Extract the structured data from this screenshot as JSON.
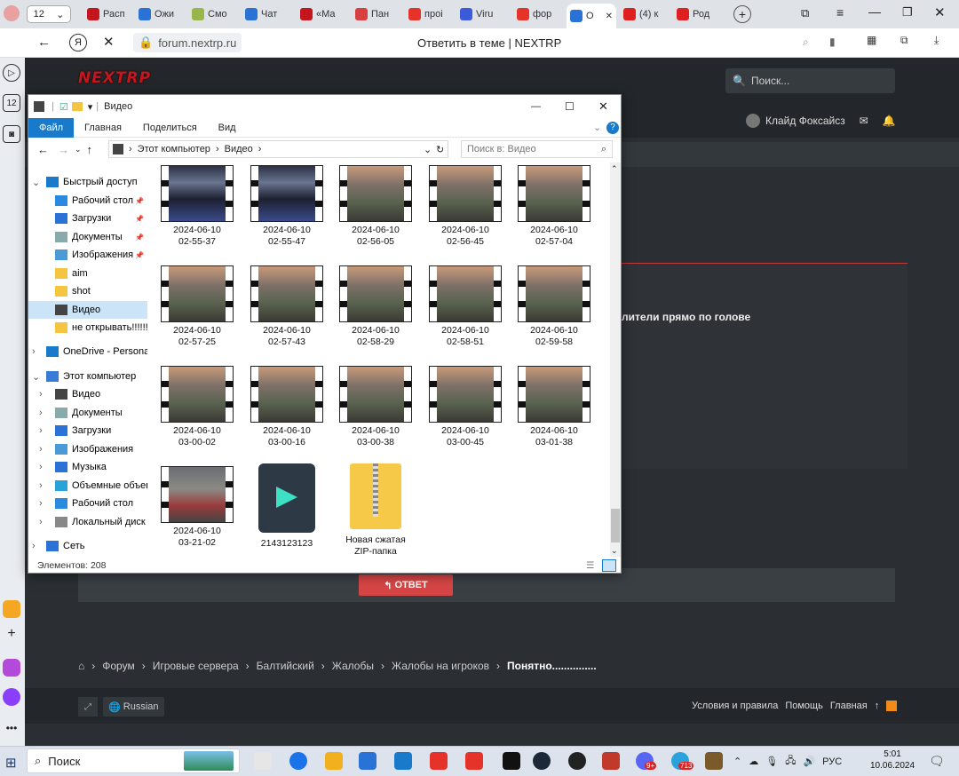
{
  "browser": {
    "tab_count": "12",
    "tabs": [
      {
        "label": "Расп",
        "color": "#c4161c"
      },
      {
        "label": "Ожи",
        "color": "#2a72d5"
      },
      {
        "label": "Смо",
        "color": "#9ab54a"
      },
      {
        "label": "Чат",
        "color": "#2a72d5"
      },
      {
        "label": "«Ма",
        "color": "#c4161c"
      },
      {
        "label": "Пан",
        "color": "#d84040"
      },
      {
        "label": "проі",
        "color": "#e6332a"
      },
      {
        "label": "Viru",
        "color": "#3b5bdb"
      },
      {
        "label": "фор",
        "color": "#e6332a"
      },
      {
        "label": "О",
        "color": "#2a72d5"
      },
      {
        "label": "(4) к",
        "color": "#e02020"
      },
      {
        "label": "Род",
        "color": "#e02020"
      }
    ],
    "url": "forum.nextrp.ru",
    "page_title": "Ответить в теме | NEXTRP"
  },
  "site": {
    "logo": "NEXTRP",
    "search_placeholder": "Поиск...",
    "username": "Клайд Фоксайсз",
    "post_text": "лители прямо по голове",
    "reply_button": "ОТВЕТ",
    "breadcrumb": [
      "Форум",
      "Игровые сервера",
      "Балтийский",
      "Жалобы",
      "Жалобы на игроков",
      "Понятно..............."
    ],
    "language": "Russian",
    "footer_links": [
      "Условия и правила",
      "Помощь",
      "Главная"
    ]
  },
  "explorer": {
    "title": "Видео",
    "ribbon_tabs": [
      "Файл",
      "Главная",
      "Поделиться",
      "Вид"
    ],
    "path": [
      "Этот компьютер",
      "Видео"
    ],
    "search_placeholder": "Поиск в: Видео",
    "nav": [
      {
        "label": "Быстрый доступ",
        "indent": 0,
        "icon": "star-icon",
        "pinned": false
      },
      {
        "label": "Рабочий стол",
        "indent": 1,
        "icon": "desktop-icon",
        "pinned": true
      },
      {
        "label": "Загрузки",
        "indent": 1,
        "icon": "download-icon",
        "pinned": true
      },
      {
        "label": "Документы",
        "indent": 1,
        "icon": "documents-icon",
        "pinned": true
      },
      {
        "label": "Изображения",
        "indent": 1,
        "icon": "pictures-icon",
        "pinned": true
      },
      {
        "label": "aim",
        "indent": 1,
        "icon": "folder-icon",
        "pinned": false
      },
      {
        "label": "shot",
        "indent": 1,
        "icon": "folder-icon",
        "pinned": false
      },
      {
        "label": "Видео",
        "indent": 1,
        "icon": "video-folder-icon",
        "pinned": false,
        "selected": true
      },
      {
        "label": "не открывать!!!!!!!!",
        "indent": 1,
        "icon": "folder-icon",
        "pinned": false
      },
      {
        "label": "OneDrive - Personal",
        "indent": 0,
        "icon": "cloud-icon",
        "pinned": false
      },
      {
        "label": "Этот компьютер",
        "indent": 0,
        "icon": "computer-icon",
        "pinned": false
      },
      {
        "label": "Видео",
        "indent": 1,
        "icon": "video-folder-icon",
        "pinned": false
      },
      {
        "label": "Документы",
        "indent": 1,
        "icon": "documents-icon",
        "pinned": false
      },
      {
        "label": "Загрузки",
        "indent": 1,
        "icon": "download-icon",
        "pinned": false
      },
      {
        "label": "Изображения",
        "indent": 1,
        "icon": "pictures-icon",
        "pinned": false
      },
      {
        "label": "Музыка",
        "indent": 1,
        "icon": "music-icon",
        "pinned": false
      },
      {
        "label": "Объемные объекты",
        "indent": 1,
        "icon": "3d-objects-icon",
        "pinned": false
      },
      {
        "label": "Рабочий стол",
        "indent": 1,
        "icon": "desktop-icon",
        "pinned": false
      },
      {
        "label": "Локальный диск (C:)",
        "indent": 1,
        "icon": "drive-icon",
        "pinned": false
      },
      {
        "label": "Сеть",
        "indent": 0,
        "icon": "network-icon",
        "pinned": false
      }
    ],
    "files": [
      {
        "name": "2024-06-10\n02-55-37",
        "type": "video",
        "tone": "ui"
      },
      {
        "name": "2024-06-10\n02-55-47",
        "type": "video",
        "tone": "ui"
      },
      {
        "name": "2024-06-10\n02-56-05",
        "type": "video",
        "tone": "game"
      },
      {
        "name": "2024-06-10\n02-56-45",
        "type": "video",
        "tone": "game"
      },
      {
        "name": "2024-06-10\n02-57-04",
        "type": "video",
        "tone": "game"
      },
      {
        "name": "2024-06-10\n02-57-25",
        "type": "video",
        "tone": "game"
      },
      {
        "name": "2024-06-10\n02-57-43",
        "type": "video",
        "tone": "game"
      },
      {
        "name": "2024-06-10\n02-58-29",
        "type": "video",
        "tone": "game"
      },
      {
        "name": "2024-06-10\n02-58-51",
        "type": "video",
        "tone": "game"
      },
      {
        "name": "2024-06-10\n02-59-58",
        "type": "video",
        "tone": "game"
      },
      {
        "name": "2024-06-10\n03-00-02",
        "type": "video",
        "tone": "game"
      },
      {
        "name": "2024-06-10\n03-00-16",
        "type": "video",
        "tone": "game"
      },
      {
        "name": "2024-06-10\n03-00-38",
        "type": "video",
        "tone": "game"
      },
      {
        "name": "2024-06-10\n03-00-45",
        "type": "video",
        "tone": "game"
      },
      {
        "name": "2024-06-10\n03-01-38",
        "type": "video",
        "tone": "game"
      },
      {
        "name": "2024-06-10\n03-21-02",
        "type": "video",
        "tone": "red"
      },
      {
        "name": "2143123123",
        "type": "filmora",
        "tone": ""
      },
      {
        "name": "Новая сжатая\nZIP-папка",
        "type": "zip",
        "tone": ""
      }
    ],
    "status": "Элементов: 208"
  },
  "taskbar": {
    "search_label": "Поиск",
    "language": "РУС",
    "time": "5:01",
    "date": "10.06.2024",
    "badges": [
      "9+",
      "713"
    ]
  }
}
